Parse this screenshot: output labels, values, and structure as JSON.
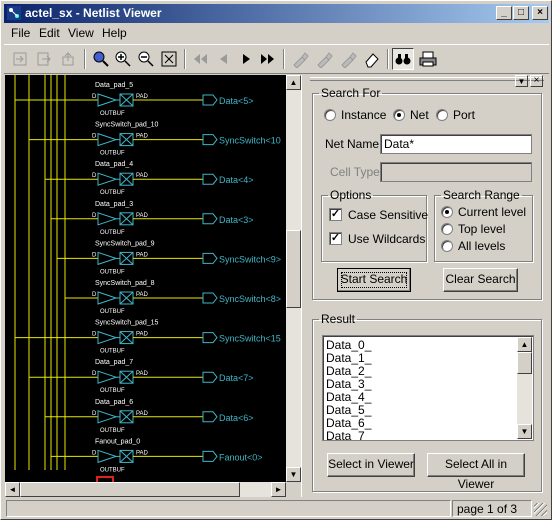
{
  "window": {
    "title": "actel_sx - Netlist Viewer",
    "minimize": "_",
    "maximize": "□",
    "close": "×"
  },
  "menu": [
    "File",
    "Edit",
    "View",
    "Help"
  ],
  "toolbar": {
    "icons": [
      "step-in-icon",
      "step-out-icon",
      "up-icon",
      "zoom-fit-icon",
      "zoom-in-icon",
      "zoom-out-icon",
      "zoom-box-icon",
      "first-page-icon",
      "prev-page-icon",
      "next-page-icon",
      "last-page-icon",
      "highlight-net-icon",
      "highlight-pin-icon",
      "highlight-instance-icon",
      "eraser-icon",
      "find-icon",
      "print-icon"
    ]
  },
  "schematic": {
    "rows": [
      {
        "instance": "Data_pad_5",
        "port": "Data<5>"
      },
      {
        "instance": "SyncSwitch_pad_10",
        "port": "SyncSwitch<10"
      },
      {
        "instance": "Data_pad_4",
        "port": "Data<4>"
      },
      {
        "instance": "Data_pad_3",
        "port": "Data<3>"
      },
      {
        "instance": "SyncSwitch_pad_9",
        "port": "SyncSwitch<9>"
      },
      {
        "instance": "SyncSwitch_pad_8",
        "port": "SyncSwitch<8>"
      },
      {
        "instance": "SyncSwitch_pad_15",
        "port": "SyncSwitch<15"
      },
      {
        "instance": "Data_pad_7",
        "port": "Data<7>"
      },
      {
        "instance": "Data_pad_6",
        "port": "Data<6>"
      },
      {
        "instance": "Fanout_pad_0",
        "port": "Fanout<0>"
      }
    ],
    "cell": "OUTBUF",
    "pin_in": "D",
    "pin_out": "PAD"
  },
  "search": {
    "group_label": "Search For",
    "types": [
      {
        "label": "Instance",
        "selected": false
      },
      {
        "label": "Net",
        "selected": true
      },
      {
        "label": "Port",
        "selected": false
      }
    ],
    "net_name_label": "Net Name",
    "net_name_value": "Data*",
    "cell_type_label": "Cell Type",
    "cell_type_value": "",
    "options_label": "Options",
    "case_sensitive": {
      "label": "Case Sensitive",
      "checked": true
    },
    "use_wildcards": {
      "label": "Use Wildcards",
      "checked": true
    },
    "range_label": "Search Range",
    "ranges": [
      {
        "label": "Current level",
        "selected": true
      },
      {
        "label": "Top level",
        "selected": false
      },
      {
        "label": "All levels",
        "selected": false
      }
    ],
    "start_button": "Start Search",
    "clear_button": "Clear Search"
  },
  "result": {
    "group_label": "Result",
    "items": [
      "Data_0_",
      "Data_1_",
      "Data_2_",
      "Data_3_",
      "Data_4_",
      "Data_5_",
      "Data_6_",
      "Data_7_"
    ],
    "select_button": "Select in Viewer",
    "select_all_button": "Select All in Viewer"
  },
  "status": {
    "page": "page 1 of 3"
  },
  "colors": {
    "wire": "#e8e800",
    "symbol": "#3fb6c8",
    "label": "#ffffff",
    "title_start": "#0a246a",
    "title_end": "#a6caf0"
  }
}
